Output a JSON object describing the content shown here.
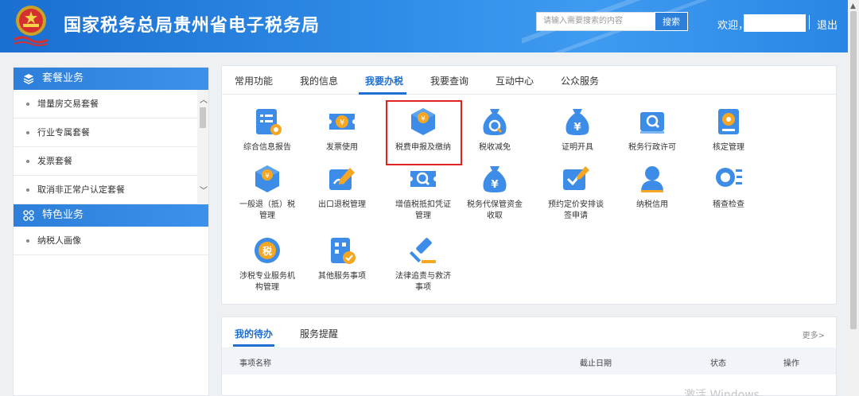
{
  "header": {
    "title": "国家税务总局贵州省电子税务局",
    "search_placeholder": "请输入需要搜索的内容",
    "search_button": "搜索",
    "welcome": "欢迎，",
    "logout": "退出"
  },
  "left_panel": {
    "package_group": "套餐业务",
    "package_items": [
      "增量房交易套餐",
      "行业专属套餐",
      "发票套餐",
      "取消非正常户认定套餐"
    ],
    "special_group": "特色业务",
    "special_items": [
      "纳税人画像"
    ]
  },
  "main_tabs": [
    "常用功能",
    "我的信息",
    "我要办税",
    "我要查询",
    "互动中心",
    "公众服务"
  ],
  "active_tab": "我要办税",
  "tiles": [
    {
      "label": "综合信息报告",
      "icon": "document-settings-icon"
    },
    {
      "label": "发票使用",
      "icon": "invoice-ticket-icon"
    },
    {
      "label": "税费申报及缴纳",
      "icon": "yuan-box-icon"
    },
    {
      "label": "税收减免",
      "icon": "money-bag-search-icon"
    },
    {
      "label": "证明开具",
      "icon": "money-bag-yuan-icon"
    },
    {
      "label": "税务行政许可",
      "icon": "license-search-icon"
    },
    {
      "label": "核定管理",
      "icon": "gear-document-icon"
    },
    {
      "label": "一般退（抵）税",
      "label2": "管理",
      "icon": "yuan-box-icon"
    },
    {
      "label": "出口退税管理",
      "icon": "pen-document-icon"
    },
    {
      "label": "增值税抵扣凭证",
      "label2": "管理",
      "icon": "ticket-search-icon"
    },
    {
      "label": "税务代保管资金",
      "label2": "收取",
      "icon": "money-bag-yuan-icon"
    },
    {
      "label": "预约定价安排谈",
      "label2": "签申请",
      "icon": "check-edit-icon"
    },
    {
      "label": "纳税信用",
      "icon": "user-icon"
    },
    {
      "label": "稽查检查",
      "icon": "search-list-icon"
    },
    {
      "label": "涉税专业服务机",
      "label2": "构管理",
      "icon": "tax-seal-icon"
    },
    {
      "label": "其他服务事项",
      "icon": "building-check-icon"
    },
    {
      "label": "法律追责与救济",
      "label2": "事项",
      "icon": "gavel-icon"
    }
  ],
  "todo": {
    "tabs": [
      "我的待办",
      "服务提醒"
    ],
    "more": "更多>",
    "columns": [
      "事项名称",
      "截止日期",
      "状态",
      "操作"
    ]
  },
  "watermark": "激活 Windows",
  "colors": {
    "brand_blue": "#1f6fd1",
    "icon_blue": "#3d8de8",
    "highlight_red": "#e02424"
  }
}
